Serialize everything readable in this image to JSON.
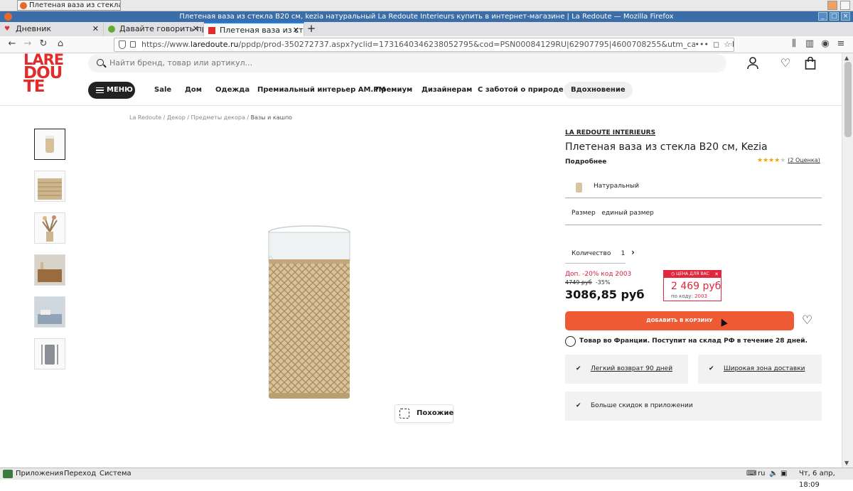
{
  "taskbar_top": {
    "window_button_label": "Плетеная ваза из стекла..."
  },
  "window": {
    "title": "Плетеная ваза из стекла B20 см, kezia натуральный La Redoute Interieurs купить в интернет-магазине | La Redoute — Mozilla Firefox"
  },
  "tabs": [
    {
      "label": "Дневник",
      "active": false
    },
    {
      "label": "Давайте говорить пра",
      "active": false
    },
    {
      "label": "Плетеная ваза из стекл",
      "active": true
    }
  ],
  "url": {
    "scheme": "https://www.",
    "host": "laredoute.ru",
    "path": "/ppdp/prod-350272737.aspx?yclid=1731640346238052795&cod=PSN00084129RU|62907795|4600708255&utm_campaign=PSN_129..."
  },
  "header": {
    "logo_lines": [
      "LARE",
      "DOU",
      "TE"
    ],
    "search_placeholder": "Найти бренд, товар или артикул...",
    "menu_label": "МЕНЮ",
    "nav": [
      "Sale",
      "Дом",
      "Одежда",
      "Премиальный интерьер AM.PM",
      "Премиум",
      "Дизайнерам",
      "С заботой о природе",
      "Вдохновение"
    ]
  },
  "breadcrumb": [
    "La Redoute",
    "Декор",
    "Предметы декора",
    "Вазы и кашпо"
  ],
  "gallery": {
    "thumbnails": [
      "vase",
      "vase-closeup",
      "vase-with-flowers",
      "sideboard-scene",
      "bedroom-scene",
      "vase-dimensions"
    ],
    "selected": 0,
    "similar_label": "Похожие"
  },
  "product": {
    "brand": "LA REDOUTE INTERIEURS",
    "title": "Плетеная ваза из стекла В20 см, Kezia",
    "details_label": "Подробнее",
    "rating_stars": 4,
    "rating_count": "(2 Оценка)",
    "color_label": "Натуральный",
    "size_label": "Размер",
    "size_value": "единый размер",
    "quantity_label": "Количество",
    "quantity_value": "1",
    "promo_text": "Доп. -20% код 2003",
    "old_price": "4749 руб",
    "discount": "-35%",
    "price": "3086,85 руб",
    "price_box": {
      "header": "ЦЕНА ДЛЯ ВАС",
      "amount": "2 469 руб",
      "code_label": "по коду:",
      "code": "2003"
    },
    "add_to_cart": "ДОБАВИТЬ В КОРЗИНУ",
    "shipping": "Товар во Франции. Поступит на склад РФ в течение 28 дней.",
    "features": [
      "Легкий возврат 90 дней",
      "Широкая зона доставки",
      "Больше скидок в приложении"
    ]
  },
  "taskbar_bottom": {
    "menu": [
      "Приложения",
      "Переход",
      "Система"
    ],
    "layout": "ru",
    "clock": "Чт, 6 апр, 18:09"
  },
  "colors": {
    "brand_red": "#e12c2c",
    "cta_orange": "#ee5a33",
    "price_red": "#e0273d",
    "firefox_blue": "#3b6ea8"
  }
}
